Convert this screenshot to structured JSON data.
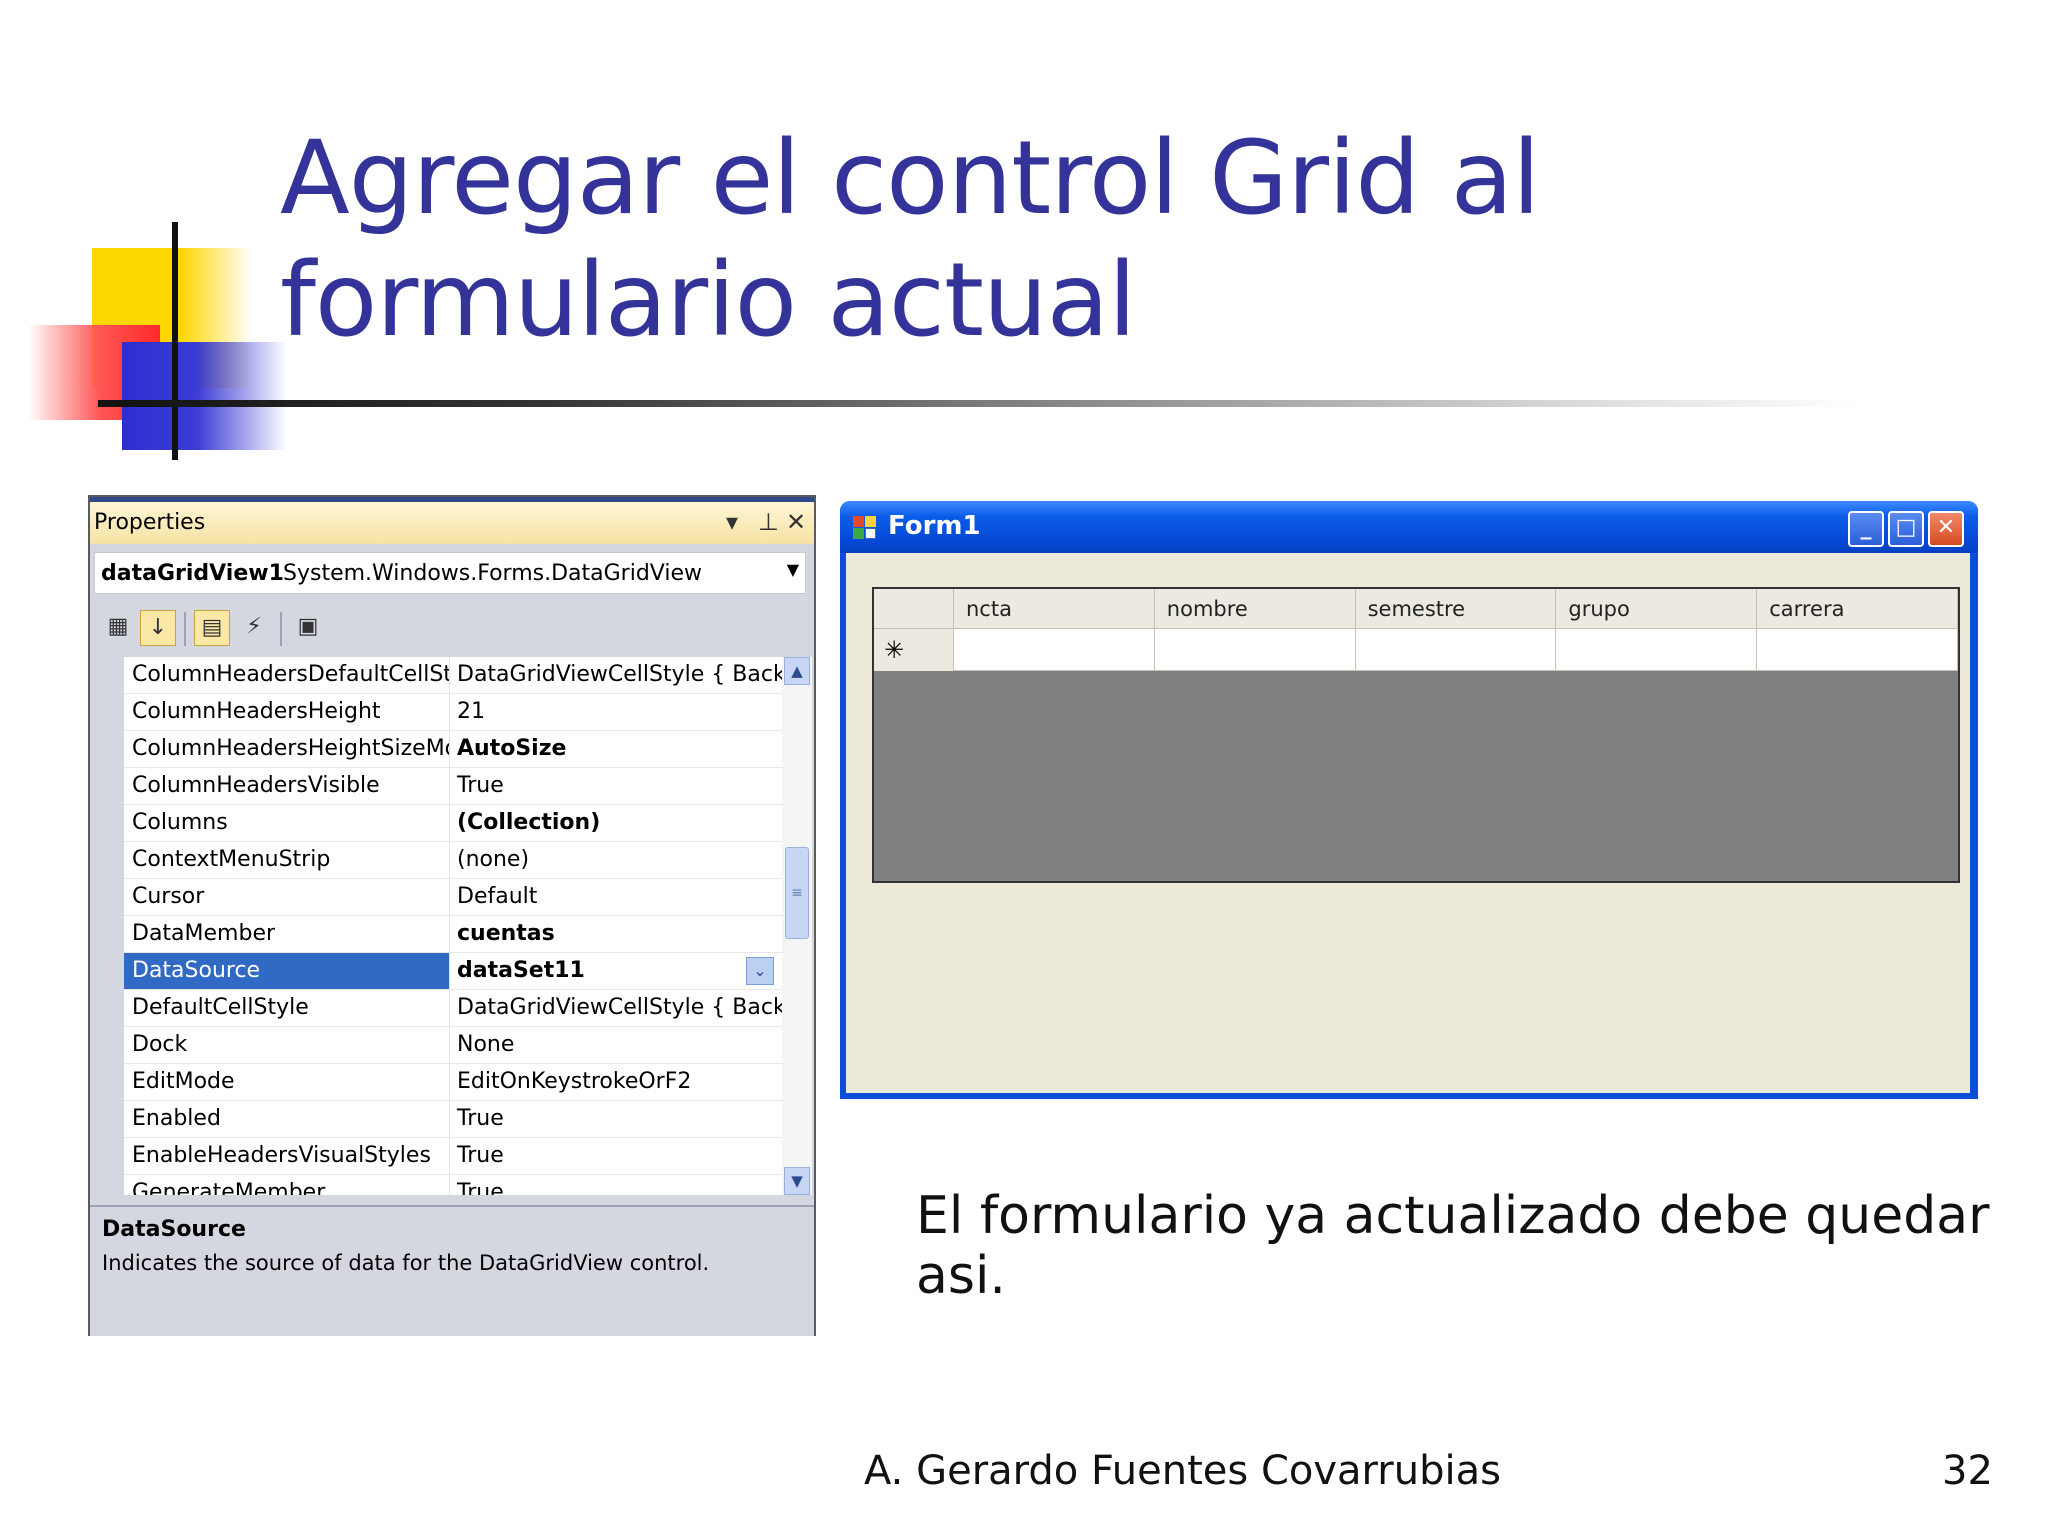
{
  "slide": {
    "title": "Agregar el control Grid al formulario actual",
    "caption": "El formulario ya actualizado debe quedar asi.",
    "footer": "A. Gerardo Fuentes Covarrubias",
    "page_number": "32"
  },
  "properties_panel": {
    "title": "Properties",
    "controls": {
      "dropdown_icon": "triangle-down",
      "pin_icon": "pin",
      "close_icon": "close-x"
    },
    "object_name": "dataGridView1",
    "object_type": "System.Windows.Forms.DataGridView",
    "toolbar": [
      "categorized-icon",
      "alphabetical-icon",
      "properties-icon",
      "events-icon",
      "property-pages-icon"
    ],
    "rows": [
      {
        "name": "ColumnHeadersDefaultCellStyle",
        "value": "DataGridViewCellStyle { BackColor",
        "bold": false
      },
      {
        "name": "ColumnHeadersHeight",
        "value": "21",
        "bold": false
      },
      {
        "name": "ColumnHeadersHeightSizeMode",
        "value": "AutoSize",
        "bold": true
      },
      {
        "name": "ColumnHeadersVisible",
        "value": "True",
        "bold": false
      },
      {
        "name": "Columns",
        "value": "(Collection)",
        "bold": true
      },
      {
        "name": "ContextMenuStrip",
        "value": "(none)",
        "bold": false
      },
      {
        "name": "Cursor",
        "value": "Default",
        "bold": false
      },
      {
        "name": "DataMember",
        "value": "cuentas",
        "bold": true
      },
      {
        "name": "DataSource",
        "value": "dataSet11",
        "bold": true,
        "selected": true
      },
      {
        "name": "DefaultCellStyle",
        "value": "DataGridViewCellStyle { BackColor",
        "bold": false
      },
      {
        "name": "Dock",
        "value": "None",
        "bold": false
      },
      {
        "name": "EditMode",
        "value": "EditOnKeystrokeOrF2",
        "bold": false
      },
      {
        "name": "Enabled",
        "value": "True",
        "bold": false
      },
      {
        "name": "EnableHeadersVisualStyles",
        "value": "True",
        "bold": false
      },
      {
        "name": "GenerateMember",
        "value": "True",
        "bold": false
      }
    ],
    "description": {
      "heading": "DataSource",
      "text": "Indicates the source of data for the DataGridView control."
    },
    "colors": {
      "selection": "#316ac5",
      "titlebar": "#f6e2a4"
    }
  },
  "form_window": {
    "title": "Form1",
    "buttons": [
      "minimize",
      "maximize",
      "close"
    ],
    "grid": {
      "columns": [
        "ncta",
        "nombre",
        "semestre",
        "grupo",
        "carrera"
      ],
      "new_row_marker": "✳"
    },
    "colors": {
      "titlebar": "#0a5ce8",
      "client": "#ece9d8",
      "grid_background": "#808080"
    }
  }
}
